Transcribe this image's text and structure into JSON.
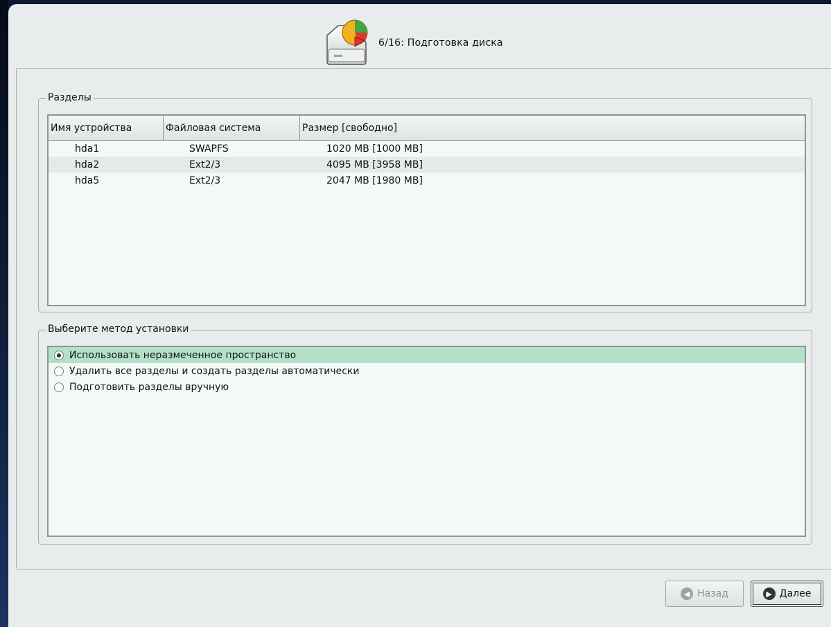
{
  "header": {
    "icon": "disk-partition-icon",
    "title": "6/16: Подготовка диска"
  },
  "partitions": {
    "group_title": "Разделы",
    "columns": [
      "Имя устройства",
      "Файловая система",
      "Размер [свободно]"
    ],
    "rows": [
      {
        "device": "hda1",
        "fs": "SWAPFS",
        "size": "1020 MB [1000 MB]"
      },
      {
        "device": "hda2",
        "fs": "Ext2/3",
        "size": "4095 MB [3958 MB]"
      },
      {
        "device": "hda5",
        "fs": "Ext2/3",
        "size": "2047 MB [1980 MB]"
      }
    ]
  },
  "method": {
    "group_title": "Выберите метод установки",
    "options": [
      {
        "label": "Использовать неразмеченное пространство",
        "selected": true
      },
      {
        "label": "Удалить все разделы и создать разделы автоматически",
        "selected": false
      },
      {
        "label": "Подготовить разделы вручную",
        "selected": false
      }
    ]
  },
  "buttons": {
    "back_label": "Назад",
    "back_icon": "arrow-left-icon",
    "next_label": "Далее",
    "next_icon": "arrow-right-icon"
  },
  "colors": {
    "selected_row": "#b3e1c8",
    "window_bg": "#e9ecec"
  }
}
